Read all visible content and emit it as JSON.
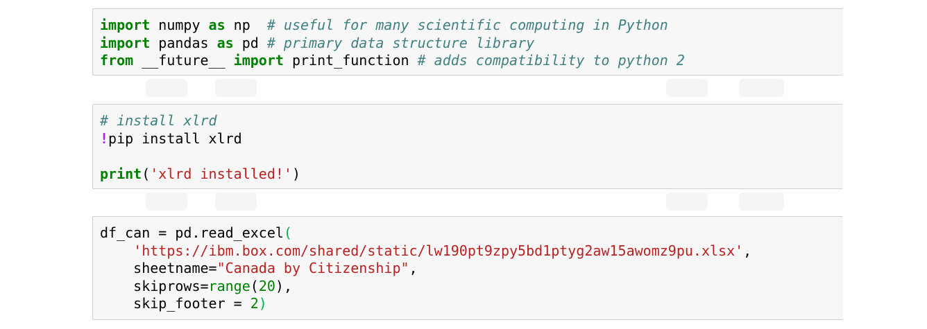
{
  "cells": [
    {
      "lines": [
        {
          "parts": [
            {
              "t": "import",
              "c": "kw"
            },
            {
              "t": " numpy ",
              "c": "gp"
            },
            {
              "t": "as",
              "c": "kw"
            },
            {
              "t": " np  ",
              "c": "gp"
            },
            {
              "t": "# useful for many scientific computing in Python",
              "c": "cm"
            }
          ]
        },
        {
          "parts": [
            {
              "t": "import",
              "c": "kw"
            },
            {
              "t": " pandas ",
              "c": "gp"
            },
            {
              "t": "as",
              "c": "kw"
            },
            {
              "t": " pd ",
              "c": "gp"
            },
            {
              "t": "# primary data structure library",
              "c": "cm"
            }
          ]
        },
        {
          "parts": [
            {
              "t": "from",
              "c": "kw"
            },
            {
              "t": " __future__ ",
              "c": "gp"
            },
            {
              "t": "import",
              "c": "kw"
            },
            {
              "t": " print_function ",
              "c": "gp"
            },
            {
              "t": "# adds compatibility to python 2",
              "c": "cm"
            }
          ]
        }
      ]
    },
    {
      "lines": [
        {
          "parts": [
            {
              "t": "# install xlrd",
              "c": "cm"
            }
          ]
        },
        {
          "parts": [
            {
              "t": "!",
              "c": "bang"
            },
            {
              "t": "pip install xlrd",
              "c": "gp"
            }
          ]
        },
        {
          "parts": [
            {
              "t": " ",
              "c": "gp"
            }
          ]
        },
        {
          "parts": [
            {
              "t": "print",
              "c": "kw"
            },
            {
              "t": "(",
              "c": "gp"
            },
            {
              "t": "'xlrd installed!'",
              "c": "st"
            },
            {
              "t": ")",
              "c": "gp"
            }
          ]
        }
      ]
    },
    {
      "lines": [
        {
          "parts": [
            {
              "t": "df_can = pd.read_excel",
              "c": "gp"
            },
            {
              "t": "(",
              "c": "paren-hl"
            }
          ]
        },
        {
          "parts": [
            {
              "t": "    ",
              "c": "gp"
            },
            {
              "t": "'https://ibm.box.com/shared/static/lw190pt9zpy5bd1ptyg2aw15awomz9pu.xlsx'",
              "c": "st"
            },
            {
              "t": ",",
              "c": "gp"
            }
          ]
        },
        {
          "parts": [
            {
              "t": "    sheetname=",
              "c": "gp"
            },
            {
              "t": "\"Canada by Citizenship\"",
              "c": "st"
            },
            {
              "t": ",",
              "c": "gp"
            }
          ]
        },
        {
          "parts": [
            {
              "t": "    skiprows=",
              "c": "gp"
            },
            {
              "t": "range",
              "c": "nb"
            },
            {
              "t": "(",
              "c": "gp"
            },
            {
              "t": "20",
              "c": "nm"
            },
            {
              "t": "),",
              "c": "gp"
            }
          ]
        },
        {
          "parts": [
            {
              "t": "    skip_footer = ",
              "c": "gp"
            },
            {
              "t": "2",
              "c": "nm"
            },
            {
              "t": ")",
              "c": "paren-hl"
            }
          ]
        }
      ]
    }
  ]
}
